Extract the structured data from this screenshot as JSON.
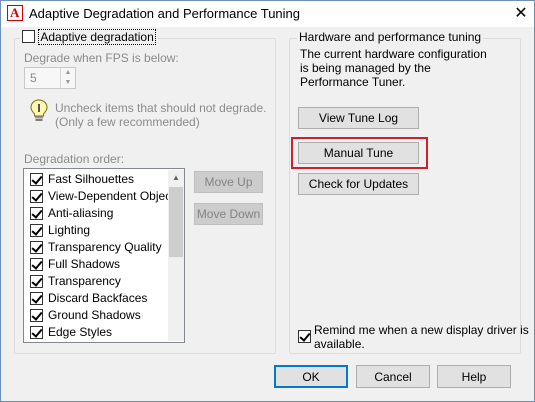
{
  "window": {
    "title": "Adaptive Degradation and Performance Tuning",
    "app_icon_letter": "A",
    "close_glyph": "✕"
  },
  "left": {
    "adaptive_degradation_label": "Adaptive degradation",
    "adaptive_degradation_checked": false,
    "fps_label": "Degrade when FPS is below:",
    "fps_value": "5",
    "hint_line1": "Uncheck items that should not degrade.",
    "hint_line2": "(Only a few recommended)",
    "degradation_order_label": "Degradation order:",
    "items": [
      {
        "label": "Fast Silhouettes",
        "checked": true
      },
      {
        "label": "View-Dependent Objects",
        "checked": true
      },
      {
        "label": "Anti-aliasing",
        "checked": true
      },
      {
        "label": "Lighting",
        "checked": true
      },
      {
        "label": "Transparency Quality",
        "checked": true
      },
      {
        "label": "Full Shadows",
        "checked": true
      },
      {
        "label": "Transparency",
        "checked": true
      },
      {
        "label": "Discard Backfaces",
        "checked": true
      },
      {
        "label": "Ground Shadows",
        "checked": true
      },
      {
        "label": "Edge Styles",
        "checked": true
      }
    ],
    "move_up_label": "Move Up",
    "move_down_label": "Move Down"
  },
  "right": {
    "group_title": "Hardware and performance tuning",
    "description_line1": "The current hardware configuration",
    "description_line2": "is being managed by the",
    "description_line3": "Performance Tuner.",
    "view_tune_log_label": "View Tune Log",
    "manual_tune_label": "Manual Tune",
    "check_updates_label": "Check for Updates",
    "remind_line1": "Remind me when a new display driver is",
    "remind_line2": "available.",
    "remind_checked": true
  },
  "footer": {
    "ok_label": "OK",
    "cancel_label": "Cancel",
    "help_label": "Help"
  },
  "colors": {
    "highlight": "#c8232c",
    "default_button_border": "#0078d7"
  }
}
